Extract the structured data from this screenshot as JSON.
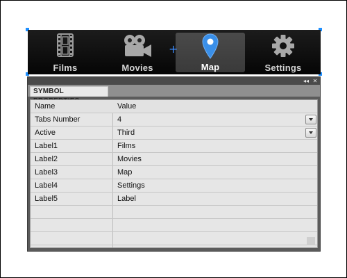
{
  "tabbar": {
    "tabs": [
      {
        "label": "Films",
        "icon": "film-strip-icon",
        "active": false
      },
      {
        "label": "Movies",
        "icon": "movie-camera-icon",
        "active": false
      },
      {
        "label": "Map",
        "icon": "map-pin-icon",
        "active": true
      },
      {
        "label": "Settings",
        "icon": "gear-icon",
        "active": false
      }
    ],
    "accent_color": "#3a8fe8"
  },
  "panel": {
    "tab_label": "SYMBOL PROPERTIES",
    "controls": {
      "collapse": "◂◂",
      "close": "✕"
    },
    "columns": {
      "name": "Name",
      "value": "Value"
    },
    "rows": [
      {
        "name": "Tabs Number",
        "value": "4",
        "has_dropdown": true
      },
      {
        "name": "Active",
        "value": "Third",
        "has_dropdown": true
      },
      {
        "name": "Label1",
        "value": "Films",
        "has_dropdown": false
      },
      {
        "name": "Label2",
        "value": "Movies",
        "has_dropdown": false
      },
      {
        "name": "Label3",
        "value": "Map",
        "has_dropdown": false
      },
      {
        "name": "Label4",
        "value": "Settings",
        "has_dropdown": false
      },
      {
        "name": "Label5",
        "value": "Label",
        "has_dropdown": false
      }
    ]
  }
}
